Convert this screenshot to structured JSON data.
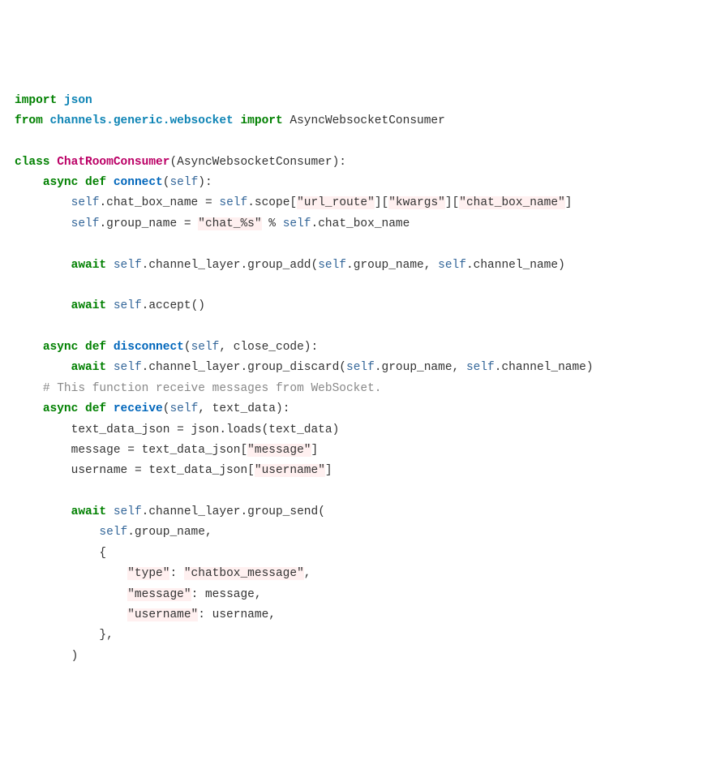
{
  "code": {
    "l1": {
      "t1": "import",
      "t2": "json"
    },
    "l2": {
      "t1": "from",
      "t2": "channels.generic.websocket",
      "t3": "import",
      "t4": "AsyncWebsocketConsumer"
    },
    "l4": {
      "t1": "class",
      "t2": "ChatRoomConsumer",
      "t3": "(AsyncWebsocketConsumer):"
    },
    "l5": {
      "t1": "async",
      "t2": "def",
      "t3": "connect",
      "t4": "(",
      "t5": "self",
      "t6": "):"
    },
    "l6": {
      "t1": "self",
      "t2": ".chat_box_name = ",
      "t3": "self",
      "t4": ".scope[",
      "s1": "\"url_route\"",
      "t5": "][",
      "s2": "\"kwargs\"",
      "t6": "][",
      "s3": "\"chat_box_name\"",
      "t7": "]"
    },
    "l7": {
      "t1": "self",
      "t2": ".group_name = ",
      "s1": "\"chat_%s\"",
      "t3": " % ",
      "t4": "self",
      "t5": ".chat_box_name"
    },
    "l9": {
      "t1": "await",
      "t2": "self",
      "t3": ".channel_layer.group_add(",
      "t4": "self",
      "t5": ".group_name, ",
      "t6": "self",
      "t7": ".channel_name)"
    },
    "l11": {
      "t1": "await",
      "t2": "self",
      "t3": ".accept()"
    },
    "l13": {
      "t1": "async",
      "t2": "def",
      "t3": "disconnect",
      "t4": "(",
      "t5": "self",
      "t6": ", close_code):"
    },
    "l14": {
      "t1": "await",
      "t2": "self",
      "t3": ".channel_layer.group_discard(",
      "t4": "self",
      "t5": ".group_name, ",
      "t6": "self",
      "t7": ".channel_name)"
    },
    "l15": {
      "t1": "# This function receive messages from WebSocket."
    },
    "l16": {
      "t1": "async",
      "t2": "def",
      "t3": "receive",
      "t4": "(",
      "t5": "self",
      "t6": ", text_data):"
    },
    "l17": {
      "t1": "text_data_json = json.loads(text_data)"
    },
    "l18": {
      "t1": "message = text_data_json[",
      "s1": "\"message\"",
      "t2": "]"
    },
    "l19": {
      "t1": "username = text_data_json[",
      "s1": "\"username\"",
      "t2": "]"
    },
    "l21": {
      "t1": "await",
      "t2": "self",
      "t3": ".channel_layer.group_send("
    },
    "l22": {
      "t1": "self",
      "t2": ".group_name,"
    },
    "l23": {
      "t1": "{"
    },
    "l24": {
      "s1": "\"type\"",
      "t1": ": ",
      "s2": "\"chatbox_message\"",
      "t2": ","
    },
    "l25": {
      "s1": "\"message\"",
      "t1": ": message,"
    },
    "l26": {
      "s1": "\"username\"",
      "t1": ": username,"
    },
    "l27": {
      "t1": "},"
    },
    "l28": {
      "t1": ")"
    }
  }
}
